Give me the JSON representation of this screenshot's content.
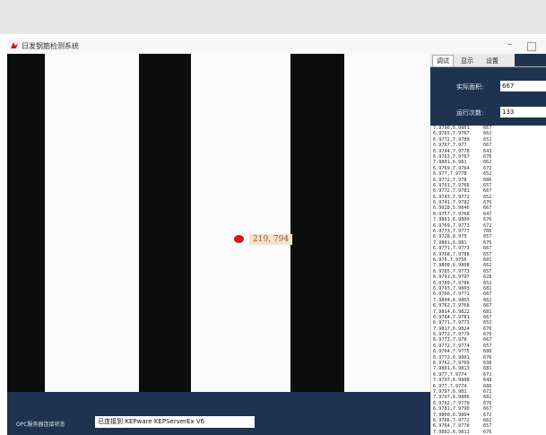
{
  "window": {
    "title": "日发钢筋检测系统",
    "minimize_symbol": "–"
  },
  "viewer": {
    "coordinate_label": "219, 794",
    "marker_color": "#d3141c"
  },
  "status": {
    "label": "OPC服务器连接状态",
    "value": "已连接到:KEPware KEPServerEx V6"
  },
  "panel": {
    "tabs": [
      "调试",
      "显示",
      "设置"
    ],
    "active_tab": 0,
    "fields": [
      {
        "label": "实际面积:",
        "value": "667"
      },
      {
        "label": "运行次数:",
        "value": "133"
      }
    ]
  },
  "log": [
    {
      "v": "7.9796,6.9801",
      "c": "667"
    },
    {
      "v": "6.9765,7.9767",
      "c": "662"
    },
    {
      "v": "6.9772,7.9789",
      "c": "651"
    },
    {
      "v": "6.9767,7.977",
      "c": "667"
    },
    {
      "v": "6.9744,7.9778",
      "c": "643"
    },
    {
      "v": "6.9763,7.9767",
      "c": "676"
    },
    {
      "v": "7.9801,6.981",
      "c": "662"
    },
    {
      "v": "6.9769,7.9764",
      "c": "672"
    },
    {
      "v": "6.977,7.9778",
      "c": "652"
    },
    {
      "v": "6.9772,7.978",
      "c": "686"
    },
    {
      "v": "6.9761,7.9766",
      "c": "657"
    },
    {
      "v": "6.9772,7.9781",
      "c": "667"
    },
    {
      "v": "6.9743,7.9772",
      "c": "652"
    },
    {
      "v": "6.9741,7.9782",
      "c": "676"
    },
    {
      "v": "6.9028,5.9046",
      "c": "667"
    },
    {
      "v": "6.9757,7.9768",
      "c": "647"
    },
    {
      "v": "7.9801,6.9809",
      "c": "676"
    },
    {
      "v": "6.9769,7.9773",
      "c": "672"
    },
    {
      "v": "6.9773,7.9777",
      "c": "706"
    },
    {
      "v": "6.9728,8.975",
      "c": "657"
    },
    {
      "v": "7.9801,6.981",
      "c": "676"
    },
    {
      "v": "6.9771,7.9773",
      "c": "667"
    },
    {
      "v": "6.9768,7.9788",
      "c": "657"
    },
    {
      "v": "6.976,7.9756",
      "c": "681"
    },
    {
      "v": "7.9808,6.9808",
      "c": "662"
    },
    {
      "v": "6.9765,7.9773",
      "c": "657"
    },
    {
      "v": "6.9791,6.9797",
      "c": "628"
    },
    {
      "v": "6.9789,7.9786",
      "c": "652"
    },
    {
      "v": "6.9793,7.9803",
      "c": "681"
    },
    {
      "v": "6.9766,7.9771",
      "c": "667"
    },
    {
      "v": "7.9804,6.9803",
      "c": "662"
    },
    {
      "v": "6.9762,7.9768",
      "c": "667"
    },
    {
      "v": "7.9814,6.9822",
      "c": "681"
    },
    {
      "v": "6.9764,7.9781",
      "c": "667"
    },
    {
      "v": "6.9771,7.9773",
      "c": "652"
    },
    {
      "v": "7.9817,6.9824",
      "c": "676"
    },
    {
      "v": "6.9772,7.9779",
      "c": "676"
    },
    {
      "v": "6.9773,7.978",
      "c": "667"
    },
    {
      "v": "6.9772,7.9774",
      "c": "657"
    },
    {
      "v": "6.9764,7.9775",
      "c": "686"
    },
    {
      "v": "6.9772,6.9801",
      "c": "676"
    },
    {
      "v": "6.9762,7.9769",
      "c": "638"
    },
    {
      "v": "7.9801,6.9813",
      "c": "681"
    },
    {
      "v": "6.977,7.9774",
      "c": "672"
    },
    {
      "v": "7.9797,6.9808",
      "c": "648"
    },
    {
      "v": "6.977,7.9774",
      "c": "686"
    },
    {
      "v": "7.9797,6.981",
      "c": "672"
    },
    {
      "v": "7.9797,6.9806",
      "c": "681"
    },
    {
      "v": "6.9762,7.9770",
      "c": "676"
    },
    {
      "v": "6.9781,7.9790",
      "c": "667"
    },
    {
      "v": "7.9800,6.9804",
      "c": "672"
    },
    {
      "v": "6.9766,7.9772",
      "c": "662"
    },
    {
      "v": "6.9764,7.9778",
      "c": "657"
    },
    {
      "v": "7.9802,6.9811",
      "c": "676"
    }
  ]
}
